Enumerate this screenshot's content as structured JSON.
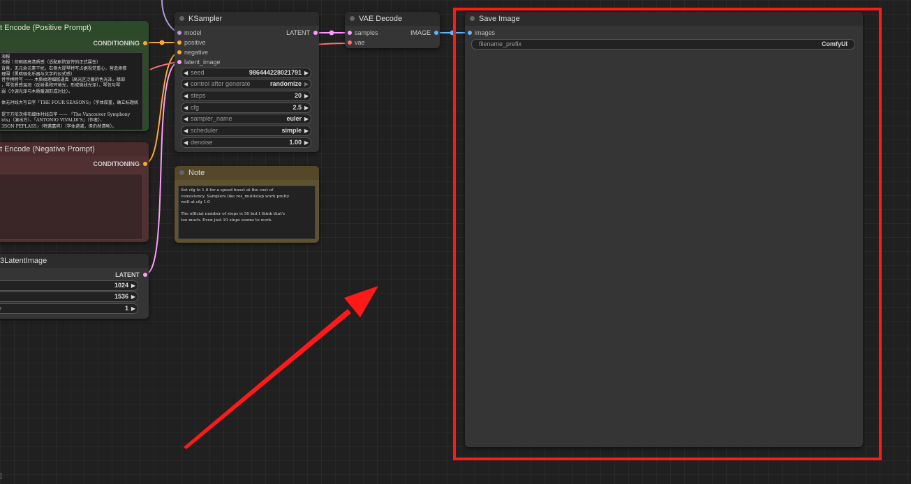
{
  "nodes": {
    "positive": {
      "title": "t Encode (Positive Prompt)",
      "output": "CONDITIONING",
      "text": "海报\n海报｜印刷级高清质感（适配剧院宣传的正式属性）\n背景，无元余元素干扰，右侧大提琴特写占据视觉重心，营造肃穆\n理围（黑暗强化乐器与文字的仪式感）\n音手柄特写 —— 木质纹理细腻逼真（高光区泛暖的色光泽，暗部\n，琴弦质感温润（反射柔和环境光，形成微线光泽），琴弦与琴\n弱（冷调光泽与木质暖调形成对比）。\n\n体无衬线大写白字「THE FOUR SEASONS」（字体厚重，确立标题统\n\n提下方依次排布细体衬线白字 —— 「The Vancouver Symphony\nnts」（演出方）、「ANTONIO VIVALDI'S」（作者）、\n3SON PEPLASS」（特邀嘉宾）（字体递减，但仍然清晰）。"
    },
    "negative": {
      "title": "t Encode (Negative Prompt)",
      "output": "CONDITIONING"
    },
    "latent": {
      "title": "3LatentImage",
      "output": "LATENT",
      "widgets": [
        {
          "name": "",
          "value": "1024"
        },
        {
          "name": "",
          "value": "1536"
        },
        {
          "name": "e",
          "value": "1"
        }
      ]
    },
    "ksampler": {
      "title": "KSampler",
      "inputs": [
        "model",
        "positive",
        "negative",
        "latent_image"
      ],
      "output": "LATENT",
      "widgets": [
        {
          "name": "seed",
          "value": "986444228021791"
        },
        {
          "name": "control after generate",
          "value": "randomize"
        },
        {
          "name": "steps",
          "value": "20"
        },
        {
          "name": "cfg",
          "value": "2.5"
        },
        {
          "name": "sampler_name",
          "value": "euler"
        },
        {
          "name": "scheduler",
          "value": "simple"
        },
        {
          "name": "denoise",
          "value": "1.00"
        }
      ]
    },
    "note": {
      "title": "Note",
      "text": "Set cfg to 1.0 for a speed boost at the cost of\nconsistency. Samplers like res_multistep work pretty\nwell at cfg 1.0\n\nThe official number of steps is 50 but I think that's\ntoo much. Even just 10 steps seems to work."
    },
    "vae_decode": {
      "title": "VAE Decode",
      "inputs": [
        "samples",
        "vae"
      ],
      "output": "IMAGE"
    },
    "save_image": {
      "title": "Save Image",
      "input": "images",
      "widget": {
        "name": "filename_prefix",
        "value": "ComfyUI"
      }
    }
  },
  "icons": {
    "left_arrow": "◀",
    "right_arrow": "▶"
  },
  "colors": {
    "highlight": "#ff1a1a",
    "model_pin": "#b39ddb",
    "conditioning_pin": "#ffa931",
    "latent_pin": "#ff9cf9",
    "vae_pin": "#ff6e6e",
    "image_pin": "#64b5f6"
  },
  "corner_text": "]"
}
